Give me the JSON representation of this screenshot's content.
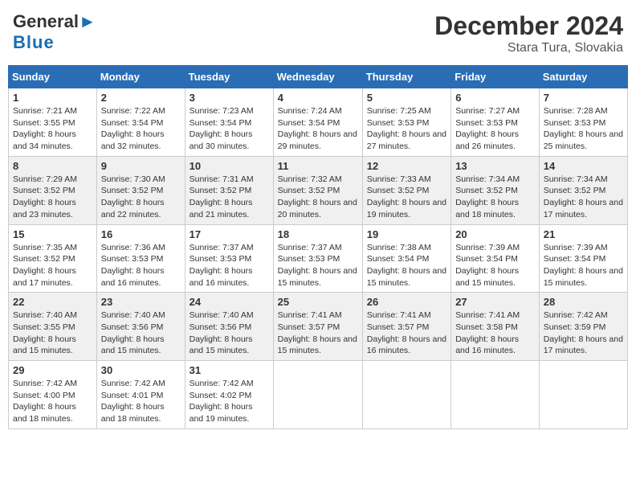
{
  "header": {
    "logo_line1": "General",
    "logo_line2": "Blue",
    "month": "December 2024",
    "location": "Stara Tura, Slovakia"
  },
  "days_of_week": [
    "Sunday",
    "Monday",
    "Tuesday",
    "Wednesday",
    "Thursday",
    "Friday",
    "Saturday"
  ],
  "weeks": [
    [
      {
        "day": "1",
        "sunrise": "Sunrise: 7:21 AM",
        "sunset": "Sunset: 3:55 PM",
        "daylight": "Daylight: 8 hours and 34 minutes."
      },
      {
        "day": "2",
        "sunrise": "Sunrise: 7:22 AM",
        "sunset": "Sunset: 3:54 PM",
        "daylight": "Daylight: 8 hours and 32 minutes."
      },
      {
        "day": "3",
        "sunrise": "Sunrise: 7:23 AM",
        "sunset": "Sunset: 3:54 PM",
        "daylight": "Daylight: 8 hours and 30 minutes."
      },
      {
        "day": "4",
        "sunrise": "Sunrise: 7:24 AM",
        "sunset": "Sunset: 3:54 PM",
        "daylight": "Daylight: 8 hours and 29 minutes."
      },
      {
        "day": "5",
        "sunrise": "Sunrise: 7:25 AM",
        "sunset": "Sunset: 3:53 PM",
        "daylight": "Daylight: 8 hours and 27 minutes."
      },
      {
        "day": "6",
        "sunrise": "Sunrise: 7:27 AM",
        "sunset": "Sunset: 3:53 PM",
        "daylight": "Daylight: 8 hours and 26 minutes."
      },
      {
        "day": "7",
        "sunrise": "Sunrise: 7:28 AM",
        "sunset": "Sunset: 3:53 PM",
        "daylight": "Daylight: 8 hours and 25 minutes."
      }
    ],
    [
      {
        "day": "8",
        "sunrise": "Sunrise: 7:29 AM",
        "sunset": "Sunset: 3:52 PM",
        "daylight": "Daylight: 8 hours and 23 minutes."
      },
      {
        "day": "9",
        "sunrise": "Sunrise: 7:30 AM",
        "sunset": "Sunset: 3:52 PM",
        "daylight": "Daylight: 8 hours and 22 minutes."
      },
      {
        "day": "10",
        "sunrise": "Sunrise: 7:31 AM",
        "sunset": "Sunset: 3:52 PM",
        "daylight": "Daylight: 8 hours and 21 minutes."
      },
      {
        "day": "11",
        "sunrise": "Sunrise: 7:32 AM",
        "sunset": "Sunset: 3:52 PM",
        "daylight": "Daylight: 8 hours and 20 minutes."
      },
      {
        "day": "12",
        "sunrise": "Sunrise: 7:33 AM",
        "sunset": "Sunset: 3:52 PM",
        "daylight": "Daylight: 8 hours and 19 minutes."
      },
      {
        "day": "13",
        "sunrise": "Sunrise: 7:34 AM",
        "sunset": "Sunset: 3:52 PM",
        "daylight": "Daylight: 8 hours and 18 minutes."
      },
      {
        "day": "14",
        "sunrise": "Sunrise: 7:34 AM",
        "sunset": "Sunset: 3:52 PM",
        "daylight": "Daylight: 8 hours and 17 minutes."
      }
    ],
    [
      {
        "day": "15",
        "sunrise": "Sunrise: 7:35 AM",
        "sunset": "Sunset: 3:52 PM",
        "daylight": "Daylight: 8 hours and 17 minutes."
      },
      {
        "day": "16",
        "sunrise": "Sunrise: 7:36 AM",
        "sunset": "Sunset: 3:53 PM",
        "daylight": "Daylight: 8 hours and 16 minutes."
      },
      {
        "day": "17",
        "sunrise": "Sunrise: 7:37 AM",
        "sunset": "Sunset: 3:53 PM",
        "daylight": "Daylight: 8 hours and 16 minutes."
      },
      {
        "day": "18",
        "sunrise": "Sunrise: 7:37 AM",
        "sunset": "Sunset: 3:53 PM",
        "daylight": "Daylight: 8 hours and 15 minutes."
      },
      {
        "day": "19",
        "sunrise": "Sunrise: 7:38 AM",
        "sunset": "Sunset: 3:54 PM",
        "daylight": "Daylight: 8 hours and 15 minutes."
      },
      {
        "day": "20",
        "sunrise": "Sunrise: 7:39 AM",
        "sunset": "Sunset: 3:54 PM",
        "daylight": "Daylight: 8 hours and 15 minutes."
      },
      {
        "day": "21",
        "sunrise": "Sunrise: 7:39 AM",
        "sunset": "Sunset: 3:54 PM",
        "daylight": "Daylight: 8 hours and 15 minutes."
      }
    ],
    [
      {
        "day": "22",
        "sunrise": "Sunrise: 7:40 AM",
        "sunset": "Sunset: 3:55 PM",
        "daylight": "Daylight: 8 hours and 15 minutes."
      },
      {
        "day": "23",
        "sunrise": "Sunrise: 7:40 AM",
        "sunset": "Sunset: 3:56 PM",
        "daylight": "Daylight: 8 hours and 15 minutes."
      },
      {
        "day": "24",
        "sunrise": "Sunrise: 7:40 AM",
        "sunset": "Sunset: 3:56 PM",
        "daylight": "Daylight: 8 hours and 15 minutes."
      },
      {
        "day": "25",
        "sunrise": "Sunrise: 7:41 AM",
        "sunset": "Sunset: 3:57 PM",
        "daylight": "Daylight: 8 hours and 15 minutes."
      },
      {
        "day": "26",
        "sunrise": "Sunrise: 7:41 AM",
        "sunset": "Sunset: 3:57 PM",
        "daylight": "Daylight: 8 hours and 16 minutes."
      },
      {
        "day": "27",
        "sunrise": "Sunrise: 7:41 AM",
        "sunset": "Sunset: 3:58 PM",
        "daylight": "Daylight: 8 hours and 16 minutes."
      },
      {
        "day": "28",
        "sunrise": "Sunrise: 7:42 AM",
        "sunset": "Sunset: 3:59 PM",
        "daylight": "Daylight: 8 hours and 17 minutes."
      }
    ],
    [
      {
        "day": "29",
        "sunrise": "Sunrise: 7:42 AM",
        "sunset": "Sunset: 4:00 PM",
        "daylight": "Daylight: 8 hours and 18 minutes."
      },
      {
        "day": "30",
        "sunrise": "Sunrise: 7:42 AM",
        "sunset": "Sunset: 4:01 PM",
        "daylight": "Daylight: 8 hours and 18 minutes."
      },
      {
        "day": "31",
        "sunrise": "Sunrise: 7:42 AM",
        "sunset": "Sunset: 4:02 PM",
        "daylight": "Daylight: 8 hours and 19 minutes."
      },
      null,
      null,
      null,
      null
    ]
  ]
}
